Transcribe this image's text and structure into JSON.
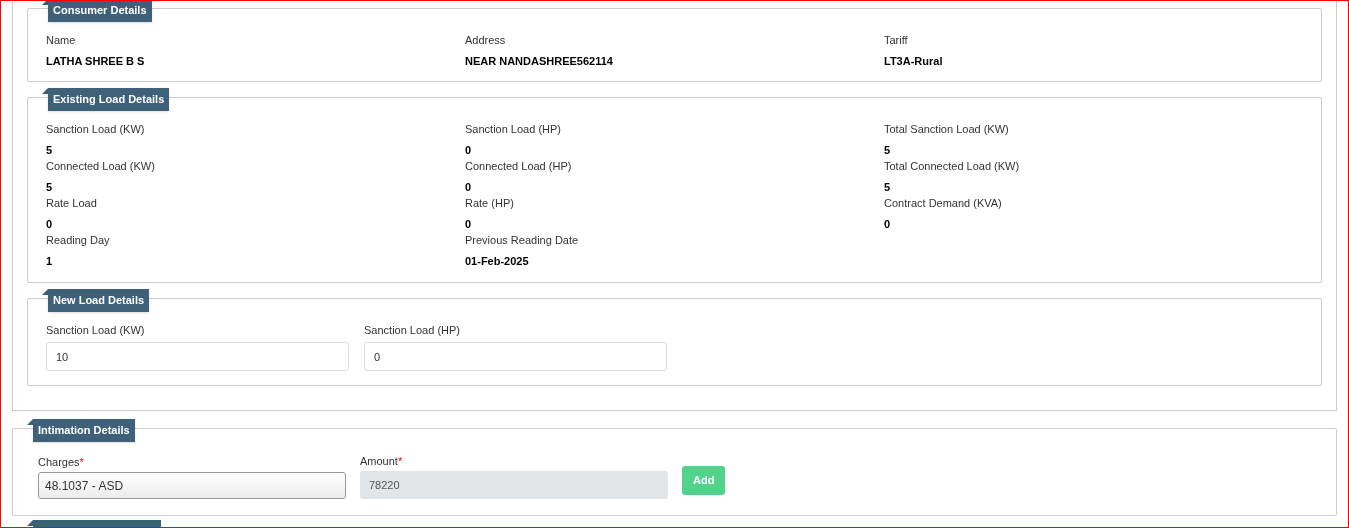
{
  "consumer_details": {
    "legend": "Consumer Details",
    "fields": [
      {
        "label": "Name",
        "value": "LATHA SHREE B S"
      },
      {
        "label": "Address",
        "value": "NEAR NANDASHREE562114"
      },
      {
        "label": "Tariff",
        "value": "LT3A-Rural"
      }
    ]
  },
  "existing_load_details": {
    "legend": "Existing Load Details",
    "fields": [
      {
        "label": "Sanction Load (KW)",
        "value": "5"
      },
      {
        "label": "Sanction Load (HP)",
        "value": "0"
      },
      {
        "label": "Total Sanction Load (KW)",
        "value": "5"
      },
      {
        "label": "Connected Load (KW)",
        "value": "5"
      },
      {
        "label": "Connected Load (HP)",
        "value": "0"
      },
      {
        "label": "Total Connected Load (KW)",
        "value": "5"
      },
      {
        "label": "Rate Load",
        "value": "0"
      },
      {
        "label": "Rate (HP)",
        "value": "0"
      },
      {
        "label": "Contract Demand (KVA)",
        "value": "0"
      },
      {
        "label": "Reading Day",
        "value": "1"
      },
      {
        "label": "Previous Reading Date",
        "value": "01-Feb-2025"
      }
    ]
  },
  "new_load_details": {
    "legend": "New Load Details",
    "inputs": [
      {
        "label": "Sanction Load (KW)",
        "value": "10"
      },
      {
        "label": "Sanction Load (HP)",
        "value": "0"
      }
    ]
  },
  "intimation_details": {
    "legend": "Intimation Details",
    "charges": {
      "label": "Charges",
      "required_mark": "*",
      "value": "48.1037 - ASD"
    },
    "amount": {
      "label": "Amount",
      "required_mark": "*",
      "value": "78220",
      "disabled": true
    },
    "add_button": "Add"
  }
}
